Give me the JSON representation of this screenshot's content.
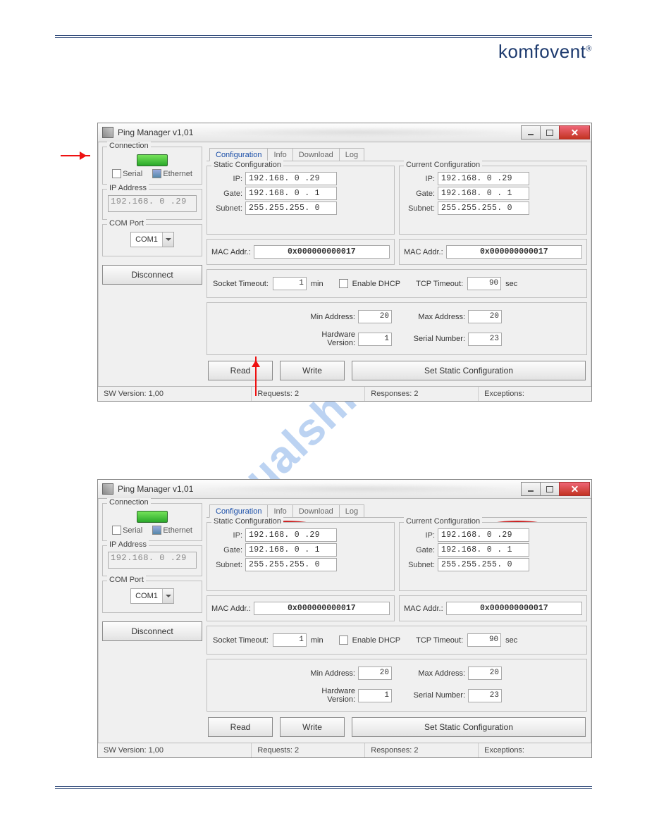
{
  "brand": "komfovent",
  "brand_mark": "®",
  "watermark": "manualshive.com",
  "window": {
    "title": "Ping Manager v1,01",
    "sw_version_label": "SW Version: 1,00",
    "requests_label": "Requests: 2",
    "responses_label": "Responses: 2",
    "exceptions_label": "Exceptions:"
  },
  "connection": {
    "group_label": "Connection",
    "serial_label": "Serial",
    "ethernet_label": "Ethernet",
    "ip_group_label": "IP Address",
    "ip_value": "192.168. 0 .29",
    "com_group_label": "COM Port",
    "com_value": "COM1",
    "disconnect_label": "Disconnect"
  },
  "tabs": {
    "configuration": "Configuration",
    "info": "Info",
    "download": "Download",
    "log": "Log"
  },
  "static_cfg": {
    "group_label": "Static Configuration",
    "ip_label": "IP:",
    "ip_value": "192.168.  0 .29",
    "gate_label": "Gate:",
    "gate_value": "192.168.  0 . 1",
    "subnet_label": "Subnet:",
    "subnet_value": "255.255.255. 0"
  },
  "current_cfg": {
    "group_label": "Current Configuration",
    "ip_label": "IP:",
    "ip_value": "192.168.  0 .29",
    "gate_label": "Gate:",
    "gate_value": "192.168.  0 . 1",
    "subnet_label": "Subnet:",
    "subnet_value": "255.255.255. 0"
  },
  "mac": {
    "label": "MAC Addr.:",
    "value": "0x000000000017"
  },
  "timeouts": {
    "socket_label": "Socket Timeout:",
    "socket_value": "1",
    "socket_unit": "min",
    "dhcp_label": "Enable DHCP",
    "tcp_label": "TCP Timeout:",
    "tcp_value": "90",
    "tcp_unit": "sec"
  },
  "device": {
    "min_addr_label": "Min Address:",
    "min_addr_value": "20",
    "max_addr_label": "Max Address:",
    "max_addr_value": "20",
    "hw_ver_label": "Hardware Version:",
    "hw_ver_value": "1",
    "serial_label": "Serial Number:",
    "serial_value": "23"
  },
  "buttons": {
    "read": "Read",
    "write": "Write",
    "set_static": "Set Static Configuration"
  }
}
